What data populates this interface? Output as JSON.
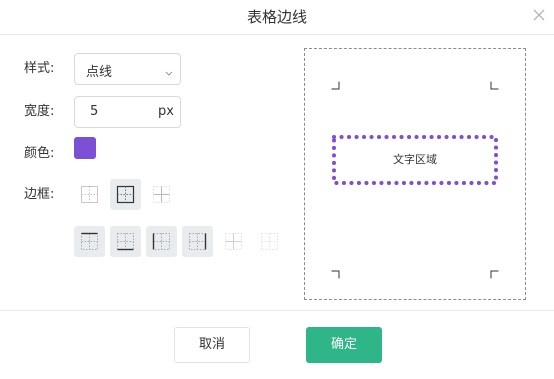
{
  "dialog": {
    "title": "表格边线",
    "close_icon": "close-icon"
  },
  "form": {
    "style_label": "样式:",
    "style_value": "点线",
    "width_label": "宽度:",
    "width_value": "5",
    "width_unit": "px",
    "color_label": "颜色:",
    "color_value": "#7d4fd4",
    "border_label": "边框:"
  },
  "border_options": {
    "row1": [
      "outer-border-icon",
      "all-borders-icon",
      "inner-borders-icon"
    ],
    "row2": [
      "top-border-icon",
      "bottom-border-icon",
      "left-border-icon",
      "right-border-icon",
      "no-outer-border-icon",
      "no-border-icon"
    ],
    "selected": "all-borders-icon"
  },
  "preview": {
    "text": "文字区域",
    "border_color": "#7d4fd4"
  },
  "footer": {
    "cancel_label": "取消",
    "ok_label": "确定"
  },
  "colors": {
    "primary": "#2fb688",
    "accent": "#7d4fd4"
  }
}
